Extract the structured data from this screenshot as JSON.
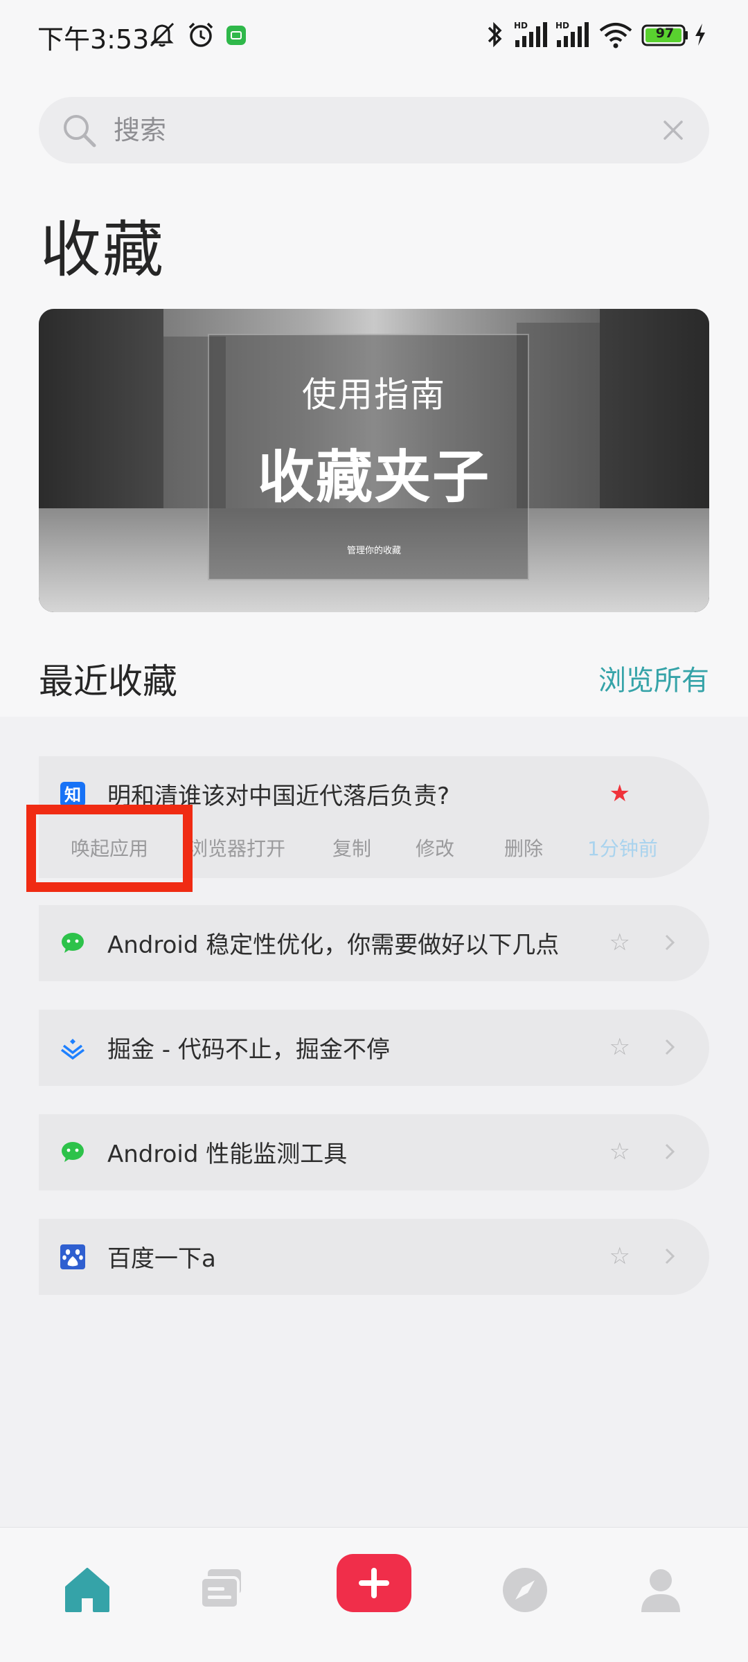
{
  "status_bar": {
    "time": "下午3:53",
    "battery": "97",
    "icons": [
      "mute-bell-icon",
      "alarm-icon",
      "app-notification-icon",
      "bluetooth-icon",
      "signal-hd-icon",
      "signal-hd-icon",
      "wifi-icon",
      "battery-icon",
      "charging-icon"
    ]
  },
  "search": {
    "placeholder": "搜索"
  },
  "page": {
    "title": "收藏"
  },
  "banner": {
    "subtitle": "使用指南",
    "title": "收藏夹子",
    "caption": "管理你的收藏"
  },
  "section": {
    "title": "最近收藏",
    "browse_all": "浏览所有"
  },
  "items": [
    {
      "title": "明和清谁该对中国近代落后负责?",
      "icon": "zhihu-icon",
      "starred": true,
      "actions": [
        "唤起应用",
        "浏览器打开",
        "复制",
        "修改",
        "删除"
      ],
      "time": "1分钟前"
    },
    {
      "title": "Android 稳定性优化，你需要做好以下几点",
      "icon": "wechat-icon",
      "starred": false
    },
    {
      "title": "掘金 - 代码不止，掘金不停",
      "icon": "juejin-icon",
      "starred": false
    },
    {
      "title": "Android 性能监测工具",
      "icon": "wechat-icon",
      "starred": false
    },
    {
      "title": "百度一下a",
      "icon": "baidu-icon",
      "starred": false
    }
  ],
  "nav": [
    "home-icon",
    "cards-icon",
    "add-icon",
    "compass-icon",
    "profile-icon"
  ],
  "colors": {
    "accent": "#35a3a8",
    "star_active": "#f0323a",
    "add_button": "#f02e4a",
    "highlight": "#f02b13"
  }
}
